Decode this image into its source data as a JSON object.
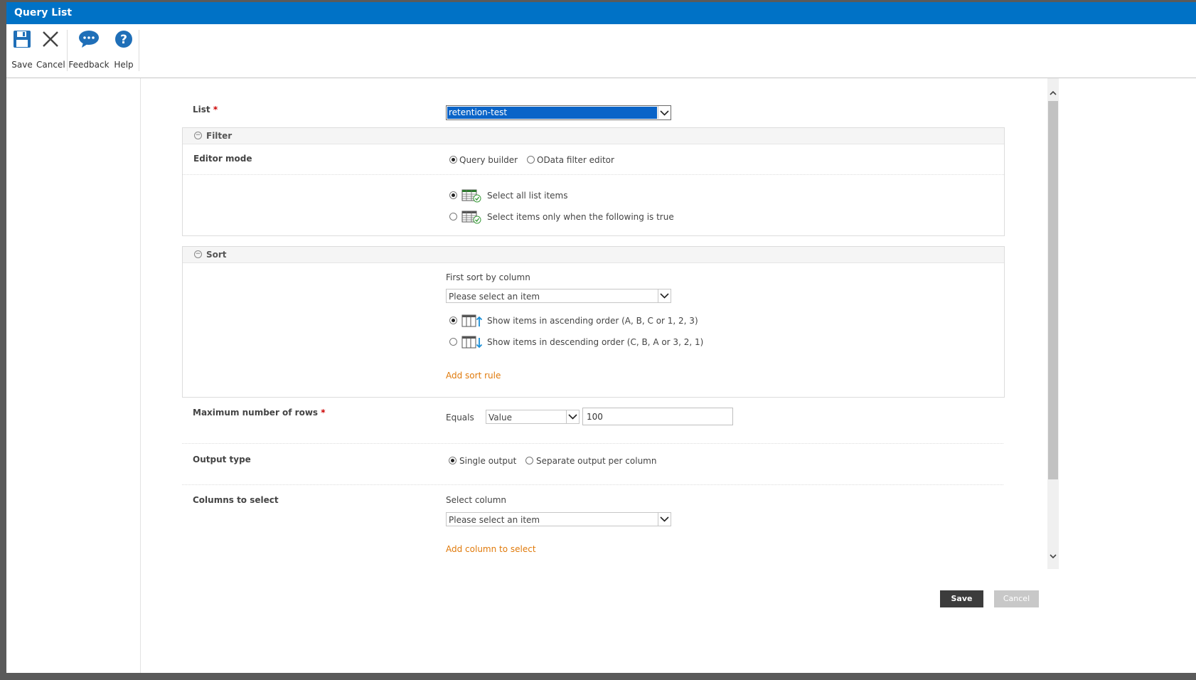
{
  "title": "Query List",
  "ribbon": {
    "save": "Save",
    "cancel": "Cancel",
    "feedback": "Feedback",
    "help": "Help"
  },
  "list": {
    "label": "List",
    "required_mark": "*",
    "selected": "retention-test"
  },
  "filter": {
    "header": "Filter",
    "editor_mode_label": "Editor mode",
    "mode_options": [
      "Query builder",
      "OData filter editor"
    ],
    "mode_selected": "Query builder",
    "select_options": [
      "Select all list items",
      "Select items only when the following is true"
    ],
    "select_selected": "Select all list items"
  },
  "sort": {
    "header": "Sort",
    "first_sort_label": "First sort by column",
    "column_placeholder": "Please select an item",
    "order_options": [
      "Show items in ascending order (A, B, C or 1, 2, 3)",
      "Show items in descending order (C, B, A or 3, 2, 1)"
    ],
    "order_selected": "Show items in ascending order (A, B, C or 1, 2, 3)",
    "add_rule": "Add sort rule"
  },
  "max_rows": {
    "label": "Maximum number of rows",
    "required_mark": "*",
    "operator": "Equals",
    "type": "Value",
    "value": "100"
  },
  "output_type": {
    "label": "Output type",
    "options": [
      "Single output",
      "Separate output per column"
    ],
    "selected": "Single output"
  },
  "columns": {
    "label": "Columns to select",
    "select_label": "Select column",
    "placeholder": "Please select an item",
    "add": "Add column to select"
  },
  "footer": {
    "save": "Save",
    "cancel": "Cancel"
  },
  "colors": {
    "titlebar": "#0072c6",
    "link": "#e07a0b",
    "highlight": "#0a64c8",
    "save_button": "#3c3c3c",
    "cancel_button": "#c8c8c8"
  }
}
